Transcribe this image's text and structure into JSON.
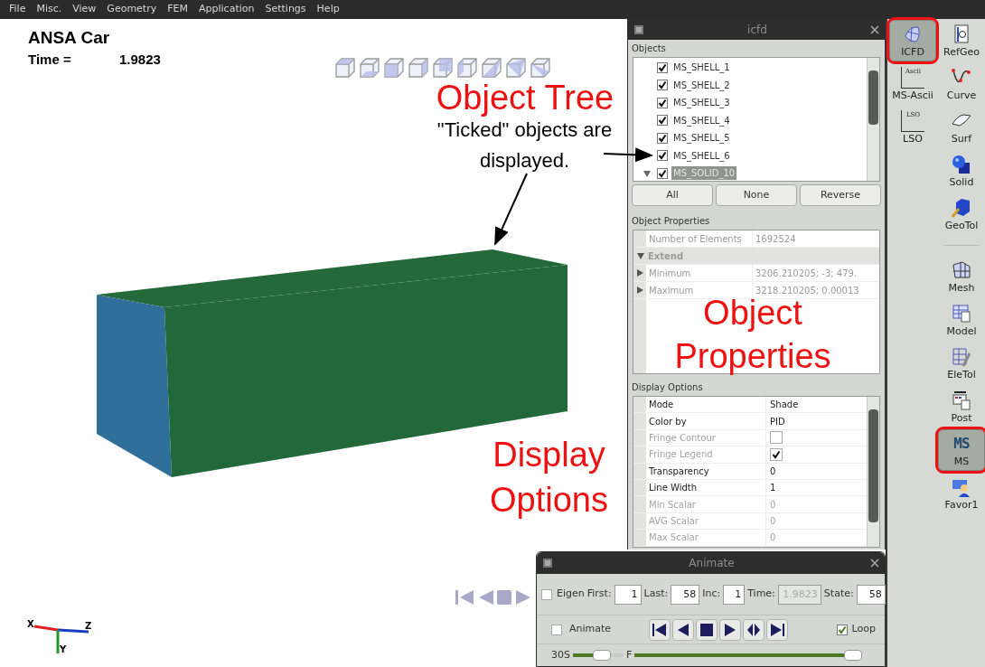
{
  "menu": [
    "File",
    "Misc.",
    "View",
    "Geometry",
    "FEM",
    "Application",
    "Settings",
    "Help"
  ],
  "viewport": {
    "title": "ANSA Car",
    "time_label": "Time =",
    "time_value": "1.9823",
    "axis_labels": [
      "X",
      "Z",
      "Y"
    ]
  },
  "annotations": [
    {
      "kind": "heading",
      "text": "Object Tree"
    },
    {
      "kind": "note",
      "text": "\"Ticked\" objects are displayed."
    },
    {
      "kind": "heading",
      "text": "Object Properties"
    },
    {
      "kind": "heading",
      "text": "Display Options"
    }
  ],
  "icfd": {
    "title": "icfd",
    "objects_label": "Objects",
    "objects": [
      {
        "kind": "leaf",
        "name": "MS_SHELL_1",
        "checked": true,
        "selected": false
      },
      {
        "kind": "leaf",
        "name": "MS_SHELL_2",
        "checked": true,
        "selected": false
      },
      {
        "kind": "leaf",
        "name": "MS_SHELL_3",
        "checked": true,
        "selected": false
      },
      {
        "kind": "leaf",
        "name": "MS_SHELL_4",
        "checked": true,
        "selected": false
      },
      {
        "kind": "leaf",
        "name": "MS_SHELL_5",
        "checked": true,
        "selected": false
      },
      {
        "kind": "leaf",
        "name": "MS_SHELL_6",
        "checked": true,
        "selected": false
      },
      {
        "kind": "group",
        "name": "MS_SOLID_10",
        "checked": true,
        "selected": true,
        "expanded": true
      }
    ],
    "buttons": [
      "All",
      "None",
      "Reverse"
    ],
    "properties_label": "Object Properties",
    "properties": [
      {
        "kind": "row",
        "name": "Number of Elements",
        "value": "1692524"
      },
      {
        "kind": "group",
        "name": "Extend",
        "expanded": true
      },
      {
        "kind": "branch",
        "name": "Minimum",
        "value": "3206.210205; -3; 479.",
        "expanded": false
      },
      {
        "kind": "branch",
        "name": "Maximum",
        "value": "3218.210205; 0.00013",
        "expanded": false
      }
    ],
    "display_label": "Display Options",
    "display": [
      {
        "kind": "text",
        "name": "Mode",
        "value": "Shade",
        "disabled": false
      },
      {
        "kind": "text",
        "name": "Color by",
        "value": "PID",
        "disabled": false
      },
      {
        "kind": "checkbox",
        "name": "Fringe Contour",
        "checked": false,
        "disabled": true
      },
      {
        "kind": "checkbox",
        "name": "Fringe Legend",
        "checked": true,
        "disabled": true
      },
      {
        "kind": "text",
        "name": "Transparency",
        "value": "0",
        "disabled": false
      },
      {
        "kind": "text",
        "name": "Line Width",
        "value": "1",
        "disabled": false
      },
      {
        "kind": "text",
        "name": "Min Scalar",
        "value": "0",
        "disabled": true
      },
      {
        "kind": "text",
        "name": "AVG Scalar",
        "value": "0",
        "disabled": true
      },
      {
        "kind": "text",
        "name": "Max Scalar",
        "value": "0",
        "disabled": true
      }
    ]
  },
  "toolbar": {
    "columns": [
      [
        {
          "kind": "tool",
          "label": "ICFD",
          "selected": true,
          "circled": true
        },
        {
          "kind": "tool",
          "label": "MS-Ascii",
          "icon_text": "Ascii",
          "selected": false,
          "circled": false
        },
        {
          "kind": "tool",
          "label": "LSO",
          "icon_text": "LSO",
          "selected": false,
          "circled": false
        }
      ],
      [
        {
          "kind": "tool",
          "label": "RefGeo",
          "selected": false,
          "circled": false
        },
        {
          "kind": "tool",
          "label": "Curve",
          "selected": false,
          "circled": false
        },
        {
          "kind": "tool",
          "label": "Surf",
          "selected": false,
          "circled": false
        },
        {
          "kind": "tool",
          "label": "Solid",
          "selected": false,
          "circled": false
        },
        {
          "kind": "tool",
          "label": "GeoTol",
          "selected": false,
          "circled": false
        },
        {
          "kind": "separator"
        },
        {
          "kind": "tool",
          "label": "Mesh",
          "selected": false,
          "circled": false
        },
        {
          "kind": "tool",
          "label": "Model",
          "selected": false,
          "circled": false
        },
        {
          "kind": "tool",
          "label": "EleTol",
          "selected": false,
          "circled": false
        },
        {
          "kind": "tool",
          "label": "Post",
          "selected": false,
          "circled": false
        },
        {
          "kind": "tool",
          "label": "MS",
          "icon_text": "MS",
          "selected": true,
          "circled": true
        },
        {
          "kind": "tool",
          "label": "Favor1",
          "selected": false,
          "circled": false
        }
      ]
    ]
  },
  "animate": {
    "title": "Animate",
    "eigen": {
      "label": "Eigen",
      "checked": false
    },
    "fields": [
      {
        "label": "First:",
        "value": "1",
        "disabled": false
      },
      {
        "label": "Last:",
        "value": "58",
        "disabled": false
      },
      {
        "label": "Inc:",
        "value": "1",
        "disabled": false
      },
      {
        "label": "Time:",
        "value": "1.9823",
        "disabled": true
      },
      {
        "label": "State:",
        "value": "58",
        "disabled": false
      }
    ],
    "animate_check": {
      "label": "Animate",
      "checked": false
    },
    "loop": {
      "label": "Loop",
      "checked": true
    },
    "speed": {
      "label": "30S",
      "level": 0.6
    },
    "frame": {
      "label": "F",
      "level": 1.0
    }
  }
}
